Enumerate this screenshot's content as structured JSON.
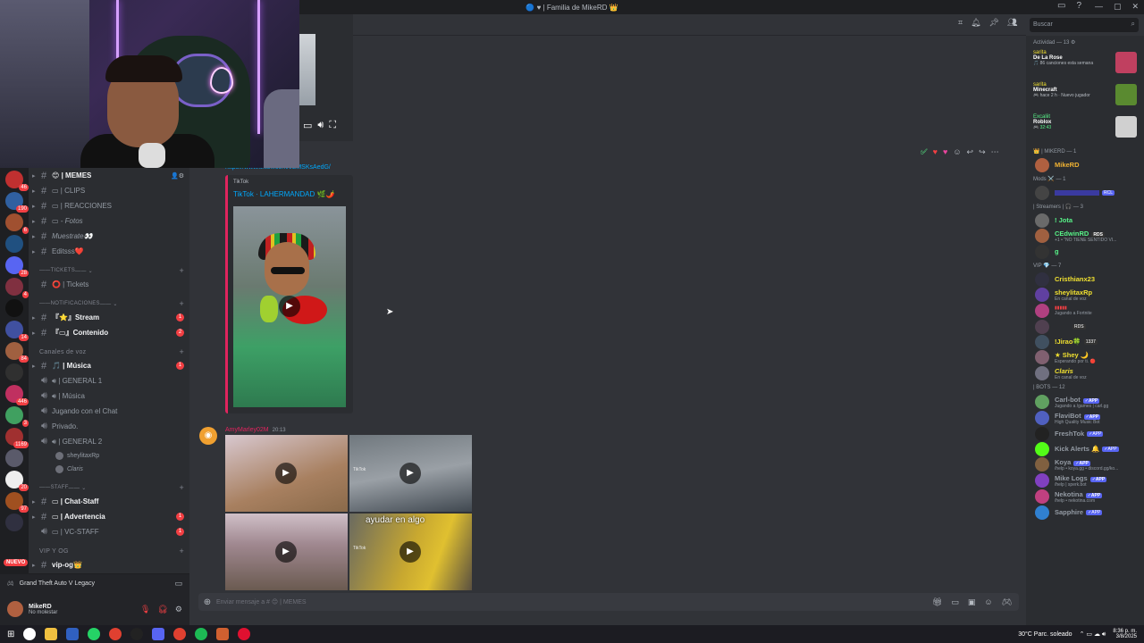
{
  "window": {
    "title": "🔵 ♥︎ | Familia de MikeRD 👑"
  },
  "search": {
    "placeholder": "Buscar"
  },
  "channels": {
    "items": [
      {
        "name": "MEMES",
        "icon": "#",
        "bright": true
      },
      {
        "name": "CLIPS",
        "icon": "#"
      },
      {
        "name": "REACCIONES",
        "icon": "#"
      },
      {
        "name": "Fotos",
        "icon": "#"
      },
      {
        "name": "Muestrate👀",
        "icon": "#"
      },
      {
        "name": "Editsss❤️",
        "icon": "#"
      }
    ],
    "tickets_cat": "TICKETS",
    "tickets": "Tickets",
    "notif_cat": "NOTIFICACIONES",
    "stream": "Stream",
    "stream_badge": "1",
    "contenido": "Contenido",
    "contenido_badge": "2",
    "voice_cat": "Canales de voz",
    "musica": "Música",
    "musica_badge": "1",
    "general1": "GENERAL 1",
    "musica2": "Música",
    "jugando": "Jugando con el Chat",
    "privado": "Privado.",
    "general2": "GENERAL 2",
    "voice_users": [
      "sheylitaxRp",
      "Claris"
    ],
    "staff_cat": "STAFF",
    "chat_staff": "Chat-Staff",
    "advertencia": "Advertencia",
    "advertencia_badge": "1",
    "vc_staff": "VC-STAFF",
    "vc_staff_badge": "1",
    "vip_cat": "VIP Y OG",
    "vip_og": "vip-og👑"
  },
  "voice_status": {
    "game": "Grand Theft Auto V Legacy"
  },
  "user": {
    "name": "MikeRD",
    "status": "No molestar"
  },
  "messages": {
    "link": "https://www.tiktok.com/t/ZMSKsAedG/",
    "embed_provider": "TikTok",
    "embed_title": "TikTok · LAHERMANDAD 🌿🌶️",
    "author2": "AmyMarley02M",
    "time2": "20:13",
    "tile_caption": "ayudar en algo",
    "tile_wm": "TikTok"
  },
  "composer": {
    "placeholder": "Enviar mensaje a # 😊 | MEMES"
  },
  "members": {
    "activity_title": "Actividad — 13 ⚙",
    "activities": [
      {
        "user": "sarita",
        "title": "De La Rose",
        "sub": "🎵 86 canciones esta semana"
      },
      {
        "user": "sarita",
        "title": "Minecraft",
        "sub": "🎮 hace 2 h · Nuevo jugador"
      },
      {
        "user": "Excaliit",
        "title": "Roblox",
        "sub": "🎮 32:43"
      }
    ],
    "g1": "👑 | MIKERD — 1",
    "g2": "Mods ⚔️ — 1",
    "g3": "| Streamers | 🎧 — 3",
    "g4": "VIP 💎 — 7",
    "g5": "| BOTS — 12",
    "list": [
      {
        "n": "MikeRD",
        "c": "#f0b232",
        "s": "",
        "av": "#b06040"
      },
      {
        "n": "",
        "c": "#5865f2",
        "s": "",
        "av": "#444",
        "tag": "RCL"
      },
      {
        "n": "! Jota",
        "c": "#57f287",
        "s": "",
        "av": "#6a6a6a"
      },
      {
        "n": "CEdwinRD",
        "c": "#57f287",
        "s": "+1 • \"NO TIENE SENTIDO VI...",
        "av": "#a06040",
        "tag": "RDS"
      },
      {
        "n": "g",
        "c": "#57f287",
        "s": "",
        "av": "#333"
      },
      {
        "n": "Cristhianx23",
        "c": "#f0e030",
        "s": "",
        "av": "#303040"
      },
      {
        "n": "sheylitaxRp",
        "c": "#f0e030",
        "s": "En canal de voz",
        "av": "#6040a0"
      },
      {
        "n": "",
        "c": "#f23f43",
        "s": "Jugando a Fortnite",
        "av": "#b04080"
      },
      {
        "n": "",
        "c": "#f0e030",
        "s": "",
        "av": "#504050",
        "tag": "RDS"
      },
      {
        "n": "!Jirao🍀",
        "c": "#f0e030",
        "s": "",
        "av": "#405060",
        "tag": "1337"
      },
      {
        "n": "★ Shey 🌙",
        "c": "#f0e030",
        "s": "Esperando por ti. 🔴",
        "av": "#806070"
      },
      {
        "n": "Claris",
        "c": "#f0e030",
        "s": "En canal de voz",
        "av": "#707080"
      },
      {
        "n": "Carl-bot",
        "c": "#949ba4",
        "s": "Jugando a /games | carl.gg",
        "av": "#60a060",
        "tag": "✓APP"
      },
      {
        "n": "FlaviBot",
        "c": "#949ba4",
        "s": "High Quality Music Bot",
        "av": "#5060c0",
        "tag": "✓APP"
      },
      {
        "n": "FreshTok",
        "c": "#949ba4",
        "s": "",
        "av": "#222",
        "tag": "✓APP"
      },
      {
        "n": "Kick Alerts 🔔",
        "c": "#949ba4",
        "s": "",
        "av": "#53fc18",
        "tag": "✓APP"
      },
      {
        "n": "Koya",
        "c": "#949ba4",
        "s": "/help • koya.gg • discord.gg/ko...",
        "av": "#806040",
        "tag": "✓APP"
      },
      {
        "n": "Mike Logs",
        "c": "#949ba4",
        "s": "/help | sperk.bot",
        "av": "#8040c0",
        "tag": "✓APP"
      },
      {
        "n": "Nekotina",
        "c": "#949ba4",
        "s": "/help • nekotina.com",
        "av": "#c04080",
        "tag": "✓APP"
      },
      {
        "n": "Sapphire",
        "c": "#949ba4",
        "s": "",
        "av": "#3080d0",
        "tag": "✓APP"
      }
    ]
  },
  "taskbar": {
    "weather": "30°C  Parc. soleado",
    "time": "8:36 p. m.",
    "date": "3/8/2025"
  }
}
